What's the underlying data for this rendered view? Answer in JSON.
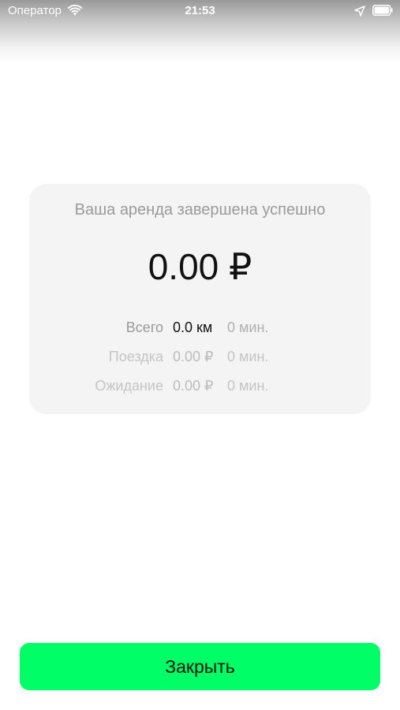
{
  "status_bar": {
    "carrier": "Оператор",
    "time": "21:53",
    "icons": [
      "wifi-icon",
      "location-icon",
      "battery-icon"
    ]
  },
  "summary": {
    "title": "Ваша аренда завершена успешно",
    "total_amount": "0.00 ₽",
    "rows": [
      {
        "label": "Всего",
        "value": "0.0 км",
        "duration": "0 мин."
      },
      {
        "label": "Поездка",
        "value": "0.00 ₽",
        "duration": "0 мин."
      },
      {
        "label": "Ожидание",
        "value": "0.00 ₽",
        "duration": "0 мин."
      }
    ]
  },
  "actions": {
    "close_label": "Закрыть"
  },
  "colors": {
    "accent": "#00ff66",
    "card_background": "#f4f4f4",
    "muted_text": "#9a9a9a"
  }
}
